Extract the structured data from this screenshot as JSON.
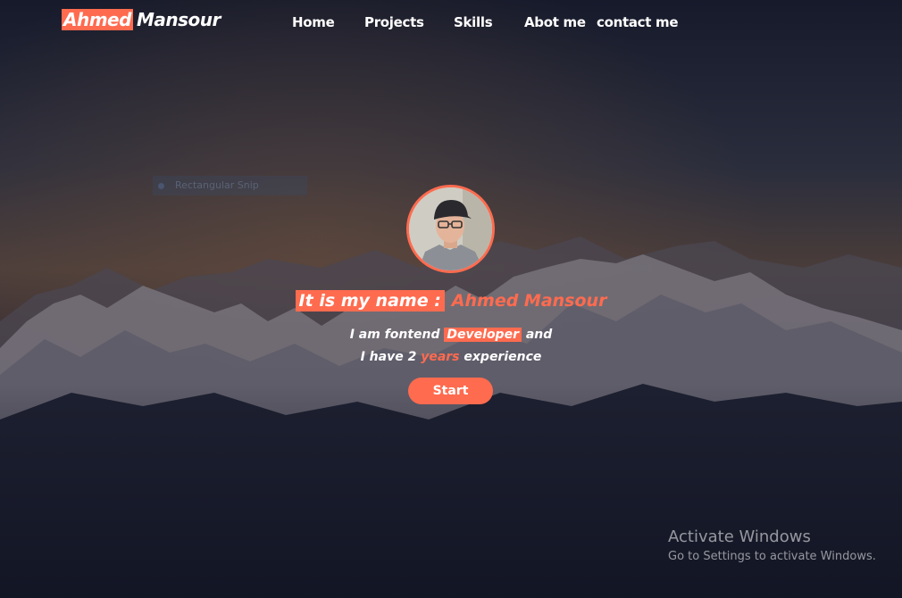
{
  "nav": {
    "logo_first": "Ahmed",
    "logo_last": "Mansour",
    "links": [
      "Home",
      "Projects",
      "Skills",
      "Abot me",
      "contact me"
    ]
  },
  "snip": {
    "label": "Rectangular Snip"
  },
  "hero": {
    "name_prefix": "It is my name :",
    "name": "Ahmed Mansour",
    "line1_a": "I am fontend",
    "line1_highlight": "Developer",
    "line1_b": "and",
    "line2_a": "I have 2",
    "line2_accent": "years",
    "line2_b": "experience",
    "start_label": "Start"
  },
  "watermark": {
    "title": "Activate Windows",
    "subtitle": "Go to Settings to activate Windows."
  },
  "colors": {
    "accent": "#ff6b4f",
    "background": "#121524"
  }
}
